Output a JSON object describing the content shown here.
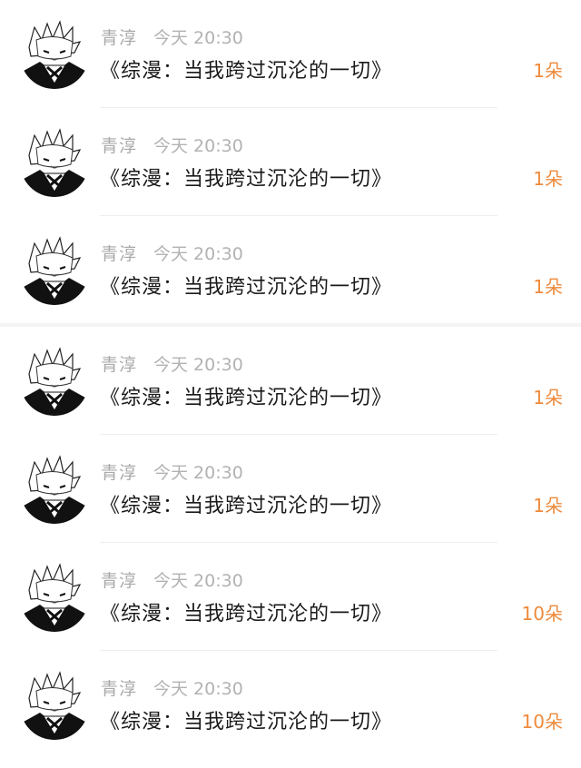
{
  "messages": [
    {
      "sender": "青淳",
      "time": "今天 20:30",
      "title": "《综漫：当我跨过沉沦的一切》",
      "count": "1朵"
    },
    {
      "sender": "青淳",
      "time": "今天 20:30",
      "title": "《综漫：当我跨过沉沦的一切》",
      "count": "1朵"
    },
    {
      "sender": "青淳",
      "time": "今天 20:30",
      "title": "《综漫：当我跨过沉沦的一切》",
      "count": "1朵"
    },
    {
      "sender": "青淳",
      "time": "今天 20:30",
      "title": "《综漫：当我跨过沉沦的一切》",
      "count": "1朵"
    },
    {
      "sender": "青淳",
      "time": "今天 20:30",
      "title": "《综漫：当我跨过沉沦的一切》",
      "count": "1朵"
    },
    {
      "sender": "青淳",
      "time": "今天 20:30",
      "title": "《综漫：当我跨过沉沦的一切》",
      "count": "10朵"
    },
    {
      "sender": "青淳",
      "time": "今天 20:30",
      "title": "《综漫：当我跨过沉沦的一切》",
      "count": "10朵"
    }
  ],
  "colors": {
    "count_accent": "#ee8a3c",
    "name_gray": "#a9a9a9",
    "title_text": "#1a1a1a"
  },
  "icons": {
    "avatar": "anime-character-avatar-icon"
  }
}
